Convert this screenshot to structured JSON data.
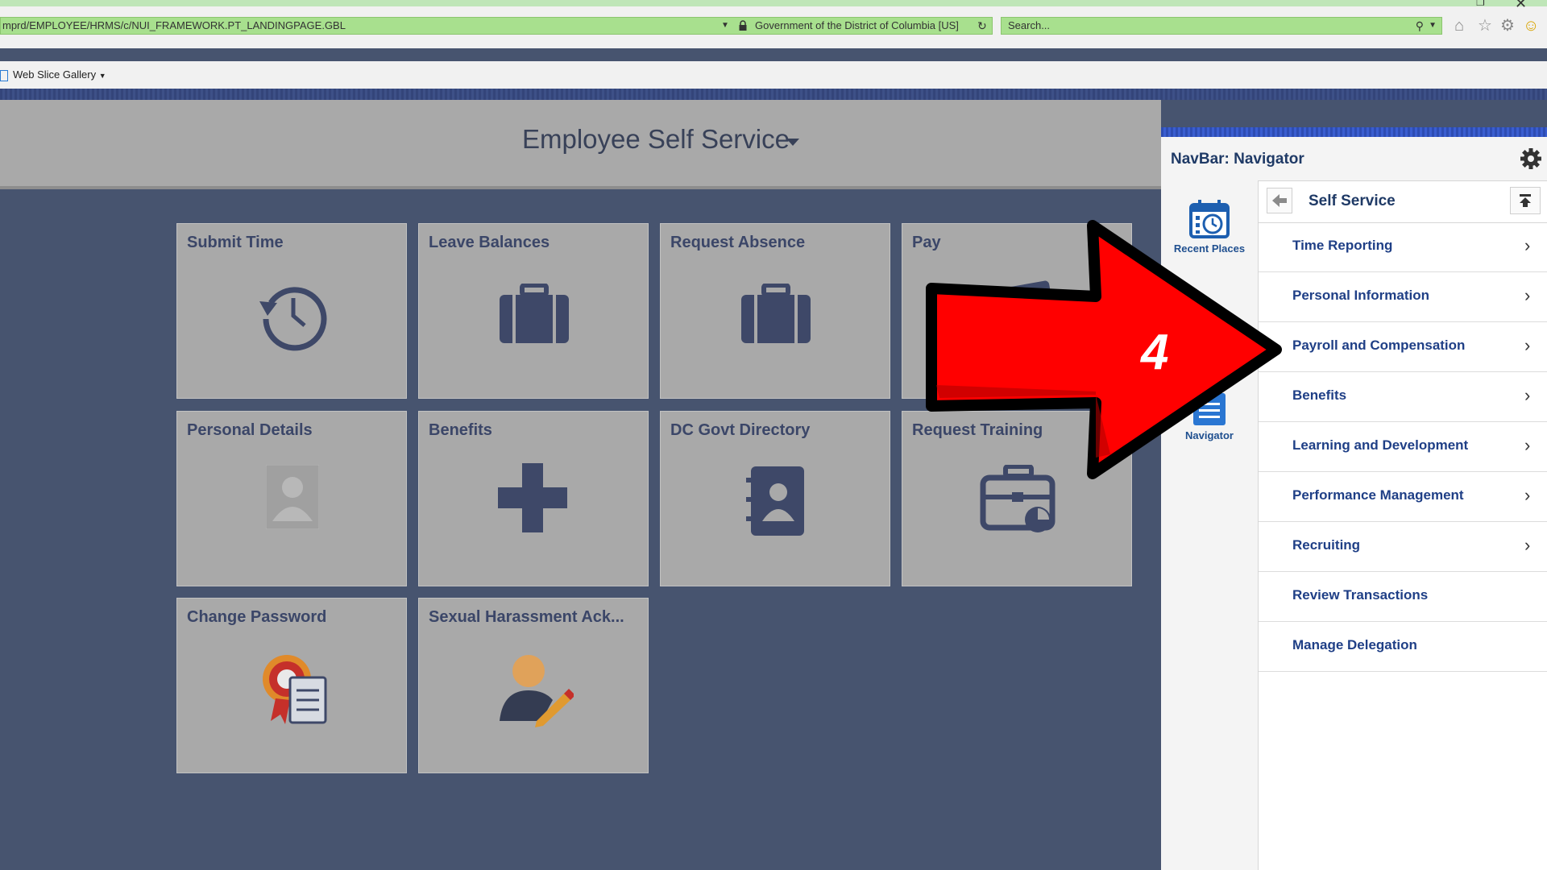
{
  "browser": {
    "url": "mprd/EMPLOYEE/HRMS/c/NUI_FRAMEWORK.PT_LANDINGPAGE.GBL",
    "site_identity": "Government of the District of Columbia [US]",
    "search_placeholder": "Search...",
    "favorites": [
      {
        "label": "Web Slice Gallery"
      }
    ]
  },
  "page": {
    "title": "Employee Self Service",
    "tiles": [
      {
        "label": "Submit Time",
        "icon": "history-clock-icon"
      },
      {
        "label": "Leave Balances",
        "icon": "briefcase-icon"
      },
      {
        "label": "Request Absence",
        "icon": "briefcase-icon"
      },
      {
        "label": "Pay",
        "icon": "payment-card-icon"
      },
      {
        "label": "Personal Details",
        "icon": "person-placeholder-icon"
      },
      {
        "label": "Benefits",
        "icon": "plus-cross-icon"
      },
      {
        "label": "DC Govt Directory",
        "icon": "address-book-icon"
      },
      {
        "label": "Request Training",
        "icon": "training-case-icon"
      },
      {
        "label": "Change Password",
        "icon": "certificate-badge-icon"
      },
      {
        "label": "Sexual Harassment Ack...",
        "icon": "user-sign-icon"
      }
    ]
  },
  "navbar": {
    "title": "NavBar: Navigator",
    "side": [
      {
        "label": "Recent Places",
        "icon": "calendar-clock-icon"
      },
      {
        "label": "Navigator",
        "icon": "navigator-list-icon"
      }
    ],
    "section_title": "Self Service",
    "menu": [
      {
        "label": "Time Reporting",
        "has_submenu": true
      },
      {
        "label": "Personal Information",
        "has_submenu": true
      },
      {
        "label": "Payroll and Compensation",
        "has_submenu": true
      },
      {
        "label": "Benefits",
        "has_submenu": true
      },
      {
        "label": "Learning and Development",
        "has_submenu": true
      },
      {
        "label": "Performance Management",
        "has_submenu": true
      },
      {
        "label": "Recruiting",
        "has_submenu": true
      },
      {
        "label": "Review Transactions",
        "has_submenu": false
      },
      {
        "label": "Manage Delegation",
        "has_submenu": false
      }
    ]
  },
  "annotation": {
    "step_number": "4",
    "color": "#ff0000"
  }
}
